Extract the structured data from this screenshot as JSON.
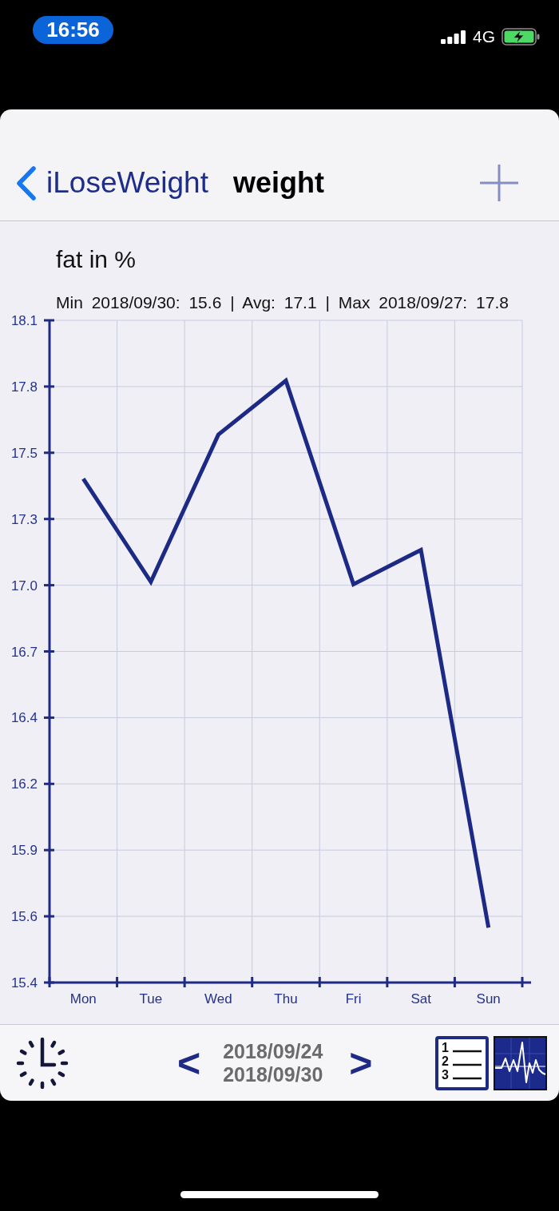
{
  "status_bar": {
    "time": "16:56",
    "network": "4G"
  },
  "nav_bar": {
    "back_label": "iLoseWeight",
    "title": "weight"
  },
  "chart_panel": {
    "summary": "Min 2018/09/30: 15.6 | Avg: 17.1 | Max 2018/09/27: 17.8",
    "chart_data": {
      "type": "line",
      "title": "fat in %",
      "categories": [
        "Mon",
        "Tue",
        "Wed",
        "Thu",
        "Fri",
        "Sat",
        "Sun"
      ],
      "values": [
        17.42,
        17.0,
        17.6,
        17.82,
        16.99,
        17.13,
        15.59
      ],
      "ylim": [
        15.366,
        18.066
      ],
      "yticks": [
        {
          "value": 15.366,
          "label": "15.4"
        },
        {
          "value": 15.636,
          "label": "15.6"
        },
        {
          "value": 15.906,
          "label": "15.9"
        },
        {
          "value": 16.176,
          "label": "16.2"
        },
        {
          "value": 16.446,
          "label": "16.4"
        },
        {
          "value": 16.716,
          "label": "16.7"
        },
        {
          "value": 16.986,
          "label": "17.0"
        },
        {
          "value": 17.256,
          "label": "17.3"
        },
        {
          "value": 17.526,
          "label": "17.5"
        },
        {
          "value": 17.796,
          "label": "17.8"
        },
        {
          "value": 18.066,
          "label": "18.1"
        }
      ],
      "grid": true
    }
  },
  "toolbar": {
    "prev": "<",
    "range_start": "2018/09/24",
    "range_end": "2018/09/30",
    "next": ">",
    "list_icon_digits": [
      "1",
      "2",
      "3"
    ]
  }
}
